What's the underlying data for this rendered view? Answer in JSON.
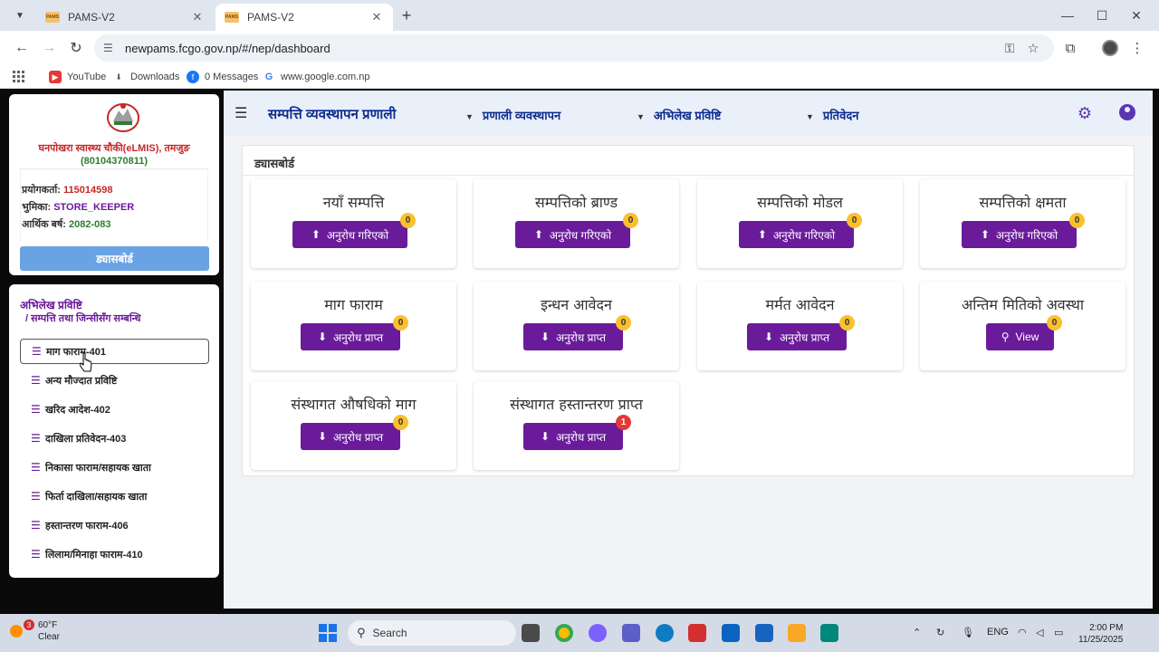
{
  "browser": {
    "tabs": [
      {
        "title": "PAMS-V2",
        "active": false
      },
      {
        "title": "PAMS-V2",
        "active": true
      }
    ],
    "url": "newpams.fcgo.gov.np/#/nep/dashboard",
    "bookmarks": [
      "YouTube",
      "Downloads",
      "0 Messages",
      "www.google.com.np"
    ],
    "favicon_text": "PAMS"
  },
  "sidebar": {
    "org_name": "घनपोखरा स्वास्थ्य चौकी(eLMIS), तमजुङ",
    "org_code": "(80104370811)",
    "user_label": "प्रयोगकर्ता:",
    "user_value": "115014598",
    "role_label": "भुमिका:",
    "role_value": "STORE_KEEPER",
    "fy_label": "आर्थिक बर्ष:",
    "fy_value": "2082-083",
    "dashboard_button": "ड्यासबोर्ड",
    "menu_title": "अभिलेख प्रविष्टि",
    "menu_subtitle": "/  सम्पत्ति तथा जिन्सीसँग सम्बन्धि",
    "items": [
      {
        "label": "माग फाराम-401",
        "selected": true
      },
      {
        "label": "अन्य मौज्दात प्रविष्टि",
        "selected": false
      },
      {
        "label": "खरिद आदेश-402",
        "selected": false
      },
      {
        "label": "दाखिला प्रतिवेदन-403",
        "selected": false
      },
      {
        "label": "निकासा फाराम/सहायक खाता",
        "selected": false
      },
      {
        "label": "फिर्ता दाखिला/सहायक खाता",
        "selected": false
      },
      {
        "label": "हस्तान्तरण फाराम-406",
        "selected": false
      },
      {
        "label": "लिलाम/मिनाहा फाराम-410",
        "selected": false
      }
    ]
  },
  "topbar": {
    "title": "सम्पत्ति व्यवस्थापन प्रणाली",
    "nav": [
      "प्रणाली व्यवस्थापन",
      "अभिलेख प्रविष्टि",
      "प्रतिवेदन"
    ]
  },
  "dashboard": {
    "title": "ड्यासबोर्ड",
    "cards": [
      {
        "title": "नयाँ सम्पत्ति",
        "button": "अनुरोध गरिएको",
        "icon": "upload-icon",
        "badge": "0"
      },
      {
        "title": "सम्पत्तिको ब्राण्ड",
        "button": "अनुरोध गरिएको",
        "icon": "upload-icon",
        "badge": "0"
      },
      {
        "title": "सम्पत्तिको मोडल",
        "button": "अनुरोध गरिएको",
        "icon": "upload-icon",
        "badge": "0"
      },
      {
        "title": "सम्पत्तिको क्षमता",
        "button": "अनुरोध गरिएको",
        "icon": "upload-icon",
        "badge": "0"
      },
      {
        "title": "माग फाराम",
        "button": "अनुरोध प्राप्त",
        "icon": "download-icon",
        "badge": "0"
      },
      {
        "title": "इन्धन आवेदन",
        "button": "अनुरोध प्राप्त",
        "icon": "download-icon",
        "badge": "0"
      },
      {
        "title": "मर्मत आवेदन",
        "button": "अनुरोध प्राप्त",
        "icon": "download-icon",
        "badge": "0"
      },
      {
        "title": "अन्तिम मितिको अवस्था",
        "button": "View",
        "icon": "search-icon",
        "badge": "0"
      },
      {
        "title": "संस्थागत औषधिको माग",
        "button": "अनुरोध प्राप्त",
        "icon": "download-icon",
        "badge": "0"
      },
      {
        "title": "संस्थागत हस्तान्तरण प्राप्त",
        "button": "अनुरोध प्राप्त",
        "icon": "download-icon",
        "badge": "1"
      }
    ]
  },
  "taskbar": {
    "weather_badge": "3",
    "temperature": "60°F",
    "condition": "Clear",
    "search": "Search",
    "language": "ENG",
    "time": "2:00 PM",
    "date": "11/25/2025"
  },
  "colors": {
    "primary": "#6a1b9a",
    "navy": "#0d2b8e",
    "badge_yellow": "#fbc02d",
    "badge_red": "#e53935",
    "dashboard_button": "#6aa3e3"
  }
}
